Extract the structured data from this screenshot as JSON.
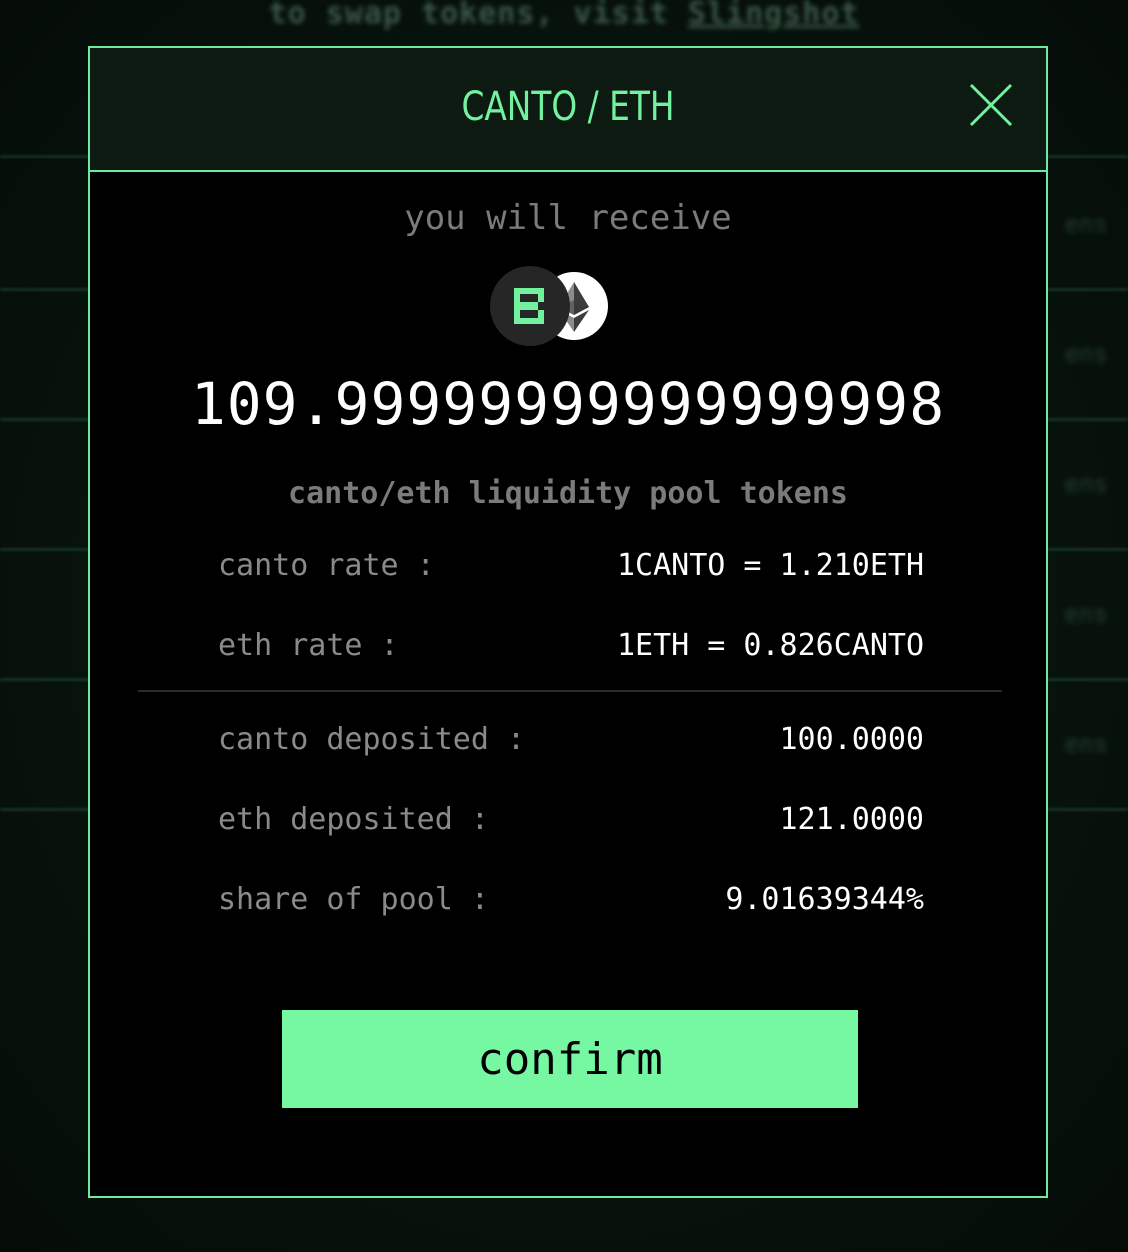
{
  "background": {
    "notice_text": "to swap tokens, visit",
    "notice_link": "Slingshot",
    "side_text": "ens"
  },
  "modal": {
    "title": "CANTO / ETH",
    "close_icon": "close-icon",
    "receive_label": "you will receive",
    "token_icons": [
      "canto-icon",
      "eth-icon"
    ],
    "amount": "109.99999999999999998",
    "pool_label": "canto/eth liquidity pool tokens",
    "rates": [
      {
        "label": "canto rate :",
        "value": "1CANTO = 1.210ETH"
      },
      {
        "label": "eth rate :",
        "value": "1ETH = 0.826CANTO"
      }
    ],
    "details": [
      {
        "label": "canto deposited :",
        "value": "100.0000"
      },
      {
        "label": "eth deposited :",
        "value": "121.0000"
      },
      {
        "label": "share of pool :",
        "value": "9.01639344%"
      }
    ],
    "confirm_label": "confirm"
  },
  "colors": {
    "accent": "#76f7a1",
    "border": "#6fe9a0",
    "muted_text": "#7b7b7b",
    "value_text": "#ffffff",
    "header_bg": "#0c1a12"
  }
}
